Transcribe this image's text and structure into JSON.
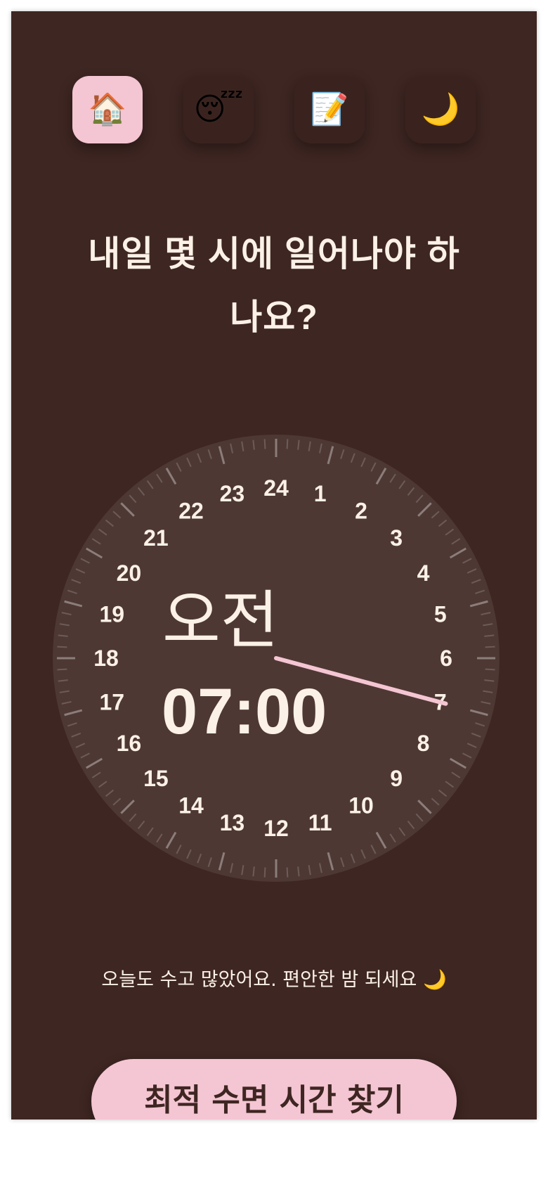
{
  "nav": {
    "items": [
      {
        "name": "home",
        "icon": "🏠",
        "active": true
      },
      {
        "name": "sleep",
        "icon": "😴",
        "active": false
      },
      {
        "name": "journal",
        "icon": "📝",
        "active": false
      },
      {
        "name": "night",
        "icon": "🌙",
        "active": false
      }
    ]
  },
  "question": {
    "line1": "내일 몇 시에 일어나야 하",
    "line2": "나요?"
  },
  "clock": {
    "hours": [
      "24",
      "1",
      "2",
      "3",
      "4",
      "5",
      "6",
      "7",
      "8",
      "9",
      "10",
      "11",
      "12",
      "13",
      "14",
      "15",
      "16",
      "17",
      "18",
      "19",
      "20",
      "21",
      "22",
      "23"
    ],
    "selected_hour": 7,
    "period": "오전",
    "time": "07:00",
    "face_color": "#4e3834",
    "hand_color": "#f4c5d2",
    "text_color": "#fbf1e6"
  },
  "message": "오늘도 수고 많았어요. 편안한 밤 되세요 🌙",
  "cta": {
    "label": "최적 수면 시간 찾기"
  },
  "colors": {
    "background": "#3e2622",
    "accent": "#f4c5d2"
  }
}
